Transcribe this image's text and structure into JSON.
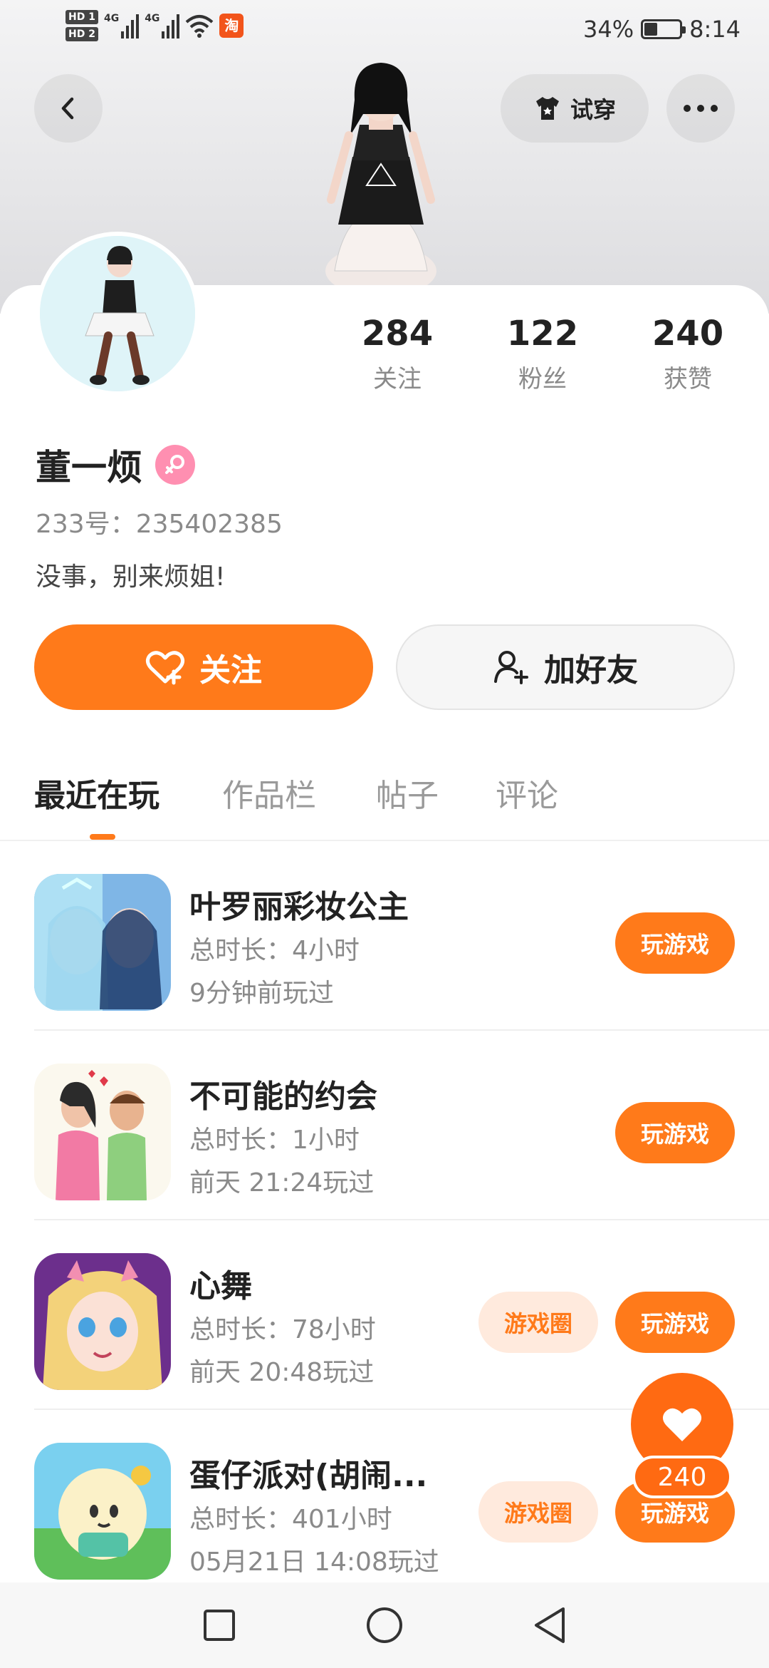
{
  "status_bar": {
    "hd1": "HD 1",
    "hd2": "HD 2",
    "signal1": "4G",
    "signal2": "4G",
    "taobao": "淘",
    "battery_percent": "34%",
    "battery_level": 0.34,
    "time": "8:14"
  },
  "topbar": {
    "back_icon": "back-arrow-icon",
    "tryon_label": "试穿",
    "tryon_icon": "tshirt-icon",
    "more_icon": "more-dots-icon"
  },
  "profile": {
    "name": "董一烦",
    "gender": "female",
    "uid": "233号：235402385",
    "bio": "没事，别来烦姐!",
    "stats": [
      {
        "value": "284",
        "label": "关注"
      },
      {
        "value": "122",
        "label": "粉丝"
      },
      {
        "value": "240",
        "label": "获赞"
      }
    ]
  },
  "actions": {
    "follow_label": "关注",
    "add_friend_label": "加好友"
  },
  "tabs": [
    {
      "label": "最近在玩",
      "active": true
    },
    {
      "label": "作品栏",
      "active": false
    },
    {
      "label": "帖子",
      "active": false
    },
    {
      "label": "评论",
      "active": false
    }
  ],
  "games": [
    {
      "title": "叶罗丽彩妆公主",
      "duration": "总时长：4小时",
      "last_played": "9分钟前玩过",
      "play_label": "玩游戏",
      "circle_label": ""
    },
    {
      "title": "不可能的约会",
      "duration": "总时长：1小时",
      "last_played": "前天 21:24玩过",
      "play_label": "玩游戏",
      "circle_label": ""
    },
    {
      "title": "心舞",
      "duration": "总时长：78小时",
      "last_played": "前天 20:48玩过",
      "play_label": "玩游戏",
      "circle_label": "游戏圈"
    },
    {
      "title": "蛋仔派对(胡闹...",
      "duration": "总时长：401小时",
      "last_played": "05月21日 14:08玩过",
      "play_label": "玩游戏",
      "circle_label": "游戏圈"
    }
  ],
  "like_fab": {
    "count": "240"
  },
  "colors": {
    "accent": "#ff7a1a",
    "gender_pink": "#ff8fb1",
    "circle_bg": "#ffeadd"
  }
}
